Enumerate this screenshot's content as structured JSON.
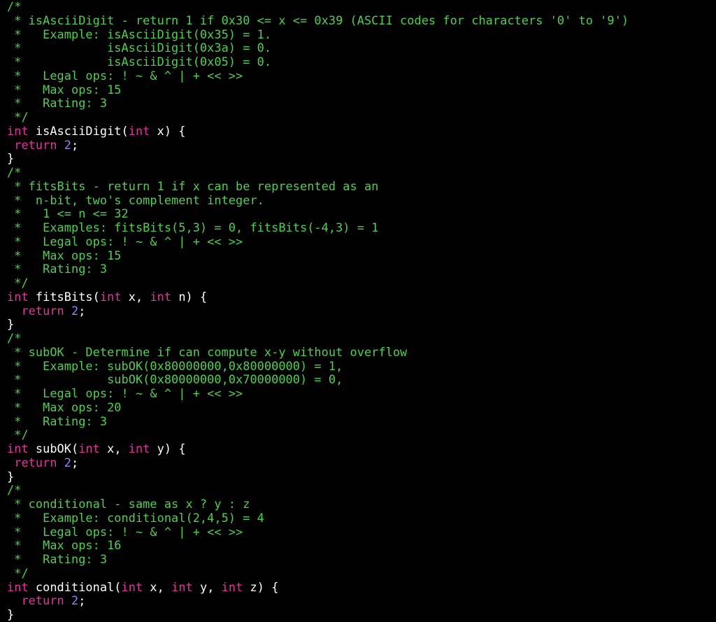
{
  "colors": {
    "background": "#000000",
    "comment": "#4fd04f",
    "keyword": "#e2359d",
    "number": "#8e84ff",
    "plain": "#ffffff"
  },
  "lines": [
    [
      {
        "t": "cm",
        "s": "/*"
      }
    ],
    [
      {
        "t": "cm",
        "s": " * isAsciiDigit - return 1 if 0x30 <= x <= 0x39 (ASCII codes for characters '0' to '9')"
      }
    ],
    [
      {
        "t": "cm",
        "s": " *   Example: isAsciiDigit(0x35) = 1."
      }
    ],
    [
      {
        "t": "cm",
        "s": " *            isAsciiDigit(0x3a) = 0."
      }
    ],
    [
      {
        "t": "cm",
        "s": " *            isAsciiDigit(0x05) = 0."
      }
    ],
    [
      {
        "t": "cm",
        "s": " *   Legal ops: ! ~ & ^ | + << >>"
      }
    ],
    [
      {
        "t": "cm",
        "s": " *   Max ops: 15"
      }
    ],
    [
      {
        "t": "cm",
        "s": " *   Rating: 3"
      }
    ],
    [
      {
        "t": "cm",
        "s": " */"
      }
    ],
    [
      {
        "t": "kw",
        "s": "int"
      },
      {
        "t": "pl",
        "s": " isAsciiDigit("
      },
      {
        "t": "kw",
        "s": "int"
      },
      {
        "t": "pl",
        "s": " x) {"
      }
    ],
    [
      {
        "t": "pl",
        "s": " "
      },
      {
        "t": "kw",
        "s": "return"
      },
      {
        "t": "pl",
        "s": " "
      },
      {
        "t": "num",
        "s": "2"
      },
      {
        "t": "pl",
        "s": ";"
      }
    ],
    [
      {
        "t": "pl",
        "s": "}"
      }
    ],
    [
      {
        "t": "cm",
        "s": "/*"
      }
    ],
    [
      {
        "t": "cm",
        "s": " * fitsBits - return 1 if x can be represented as an"
      }
    ],
    [
      {
        "t": "cm",
        "s": " *  n-bit, two's complement integer."
      }
    ],
    [
      {
        "t": "cm",
        "s": " *   1 <= n <= 32"
      }
    ],
    [
      {
        "t": "cm",
        "s": " *   Examples: fitsBits(5,3) = 0, fitsBits(-4,3) = 1"
      }
    ],
    [
      {
        "t": "cm",
        "s": " *   Legal ops: ! ~ & ^ | + << >>"
      }
    ],
    [
      {
        "t": "cm",
        "s": " *   Max ops: 15"
      }
    ],
    [
      {
        "t": "cm",
        "s": " *   Rating: 3"
      }
    ],
    [
      {
        "t": "cm",
        "s": " */"
      }
    ],
    [
      {
        "t": "kw",
        "s": "int"
      },
      {
        "t": "pl",
        "s": " fitsBits("
      },
      {
        "t": "kw",
        "s": "int"
      },
      {
        "t": "pl",
        "s": " x, "
      },
      {
        "t": "kw",
        "s": "int"
      },
      {
        "t": "pl",
        "s": " n) {"
      }
    ],
    [
      {
        "t": "pl",
        "s": "  "
      },
      {
        "t": "kw",
        "s": "return"
      },
      {
        "t": "pl",
        "s": " "
      },
      {
        "t": "num",
        "s": "2"
      },
      {
        "t": "pl",
        "s": ";"
      }
    ],
    [
      {
        "t": "pl",
        "s": "}"
      }
    ],
    [
      {
        "t": "cm",
        "s": "/*"
      }
    ],
    [
      {
        "t": "cm",
        "s": " * subOK - Determine if can compute x-y without overflow"
      }
    ],
    [
      {
        "t": "cm",
        "s": " *   Example: subOK(0x80000000,0x80000000) = 1,"
      }
    ],
    [
      {
        "t": "cm",
        "s": " *            subOK(0x80000000,0x70000000) = 0,"
      }
    ],
    [
      {
        "t": "cm",
        "s": " *   Legal ops: ! ~ & ^ | + << >>"
      }
    ],
    [
      {
        "t": "cm",
        "s": " *   Max ops: 20"
      }
    ],
    [
      {
        "t": "cm",
        "s": " *   Rating: 3"
      }
    ],
    [
      {
        "t": "cm",
        "s": " */"
      }
    ],
    [
      {
        "t": "kw",
        "s": "int"
      },
      {
        "t": "pl",
        "s": " subOK("
      },
      {
        "t": "kw",
        "s": "int"
      },
      {
        "t": "pl",
        "s": " x, "
      },
      {
        "t": "kw",
        "s": "int"
      },
      {
        "t": "pl",
        "s": " y) {"
      }
    ],
    [
      {
        "t": "pl",
        "s": " "
      },
      {
        "t": "kw",
        "s": "return"
      },
      {
        "t": "pl",
        "s": " "
      },
      {
        "t": "num",
        "s": "2"
      },
      {
        "t": "pl",
        "s": ";"
      }
    ],
    [
      {
        "t": "pl",
        "s": "}"
      }
    ],
    [
      {
        "t": "cm",
        "s": "/*"
      }
    ],
    [
      {
        "t": "cm",
        "s": " * conditional - same as x ? y : z"
      }
    ],
    [
      {
        "t": "cm",
        "s": " *   Example: conditional(2,4,5) = 4"
      }
    ],
    [
      {
        "t": "cm",
        "s": " *   Legal ops: ! ~ & ^ | + << >>"
      }
    ],
    [
      {
        "t": "cm",
        "s": " *   Max ops: 16"
      }
    ],
    [
      {
        "t": "cm",
        "s": " *   Rating: 3"
      }
    ],
    [
      {
        "t": "cm",
        "s": " */"
      }
    ],
    [
      {
        "t": "kw",
        "s": "int"
      },
      {
        "t": "pl",
        "s": " conditional("
      },
      {
        "t": "kw",
        "s": "int"
      },
      {
        "t": "pl",
        "s": " x, "
      },
      {
        "t": "kw",
        "s": "int"
      },
      {
        "t": "pl",
        "s": " y, "
      },
      {
        "t": "kw",
        "s": "int"
      },
      {
        "t": "pl",
        "s": " z) {"
      }
    ],
    [
      {
        "t": "pl",
        "s": "  "
      },
      {
        "t": "kw",
        "s": "return"
      },
      {
        "t": "pl",
        "s": " "
      },
      {
        "t": "num",
        "s": "2"
      },
      {
        "t": "pl",
        "s": ";"
      }
    ],
    [
      {
        "t": "pl",
        "s": "}"
      }
    ]
  ]
}
